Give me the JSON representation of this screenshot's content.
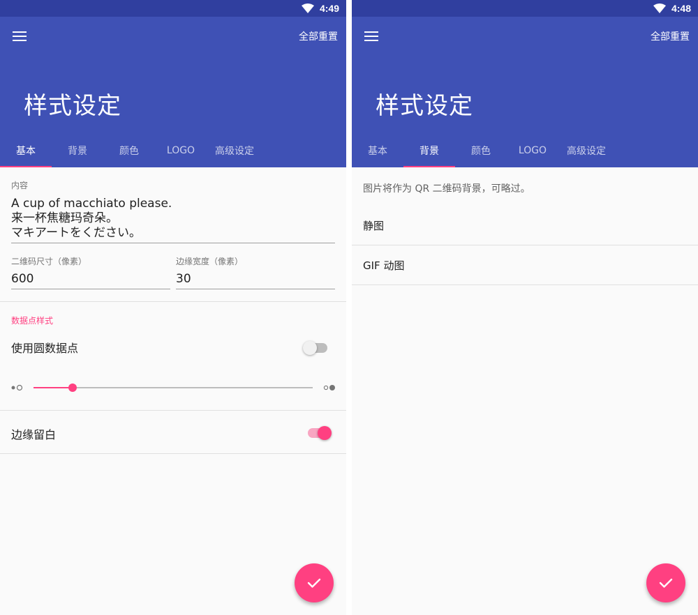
{
  "colors": {
    "primary": "#3f51b5",
    "primary_dark": "#303f9f",
    "accent": "#ff4081",
    "background": "#fafafa"
  },
  "left_screen": {
    "status": {
      "time": "4:49",
      "icons": [
        "wifi-icon"
      ]
    },
    "appbar": {
      "reset_label": "全部重置",
      "title": "样式设定"
    },
    "tabs": [
      {
        "label": "基本",
        "active": true
      },
      {
        "label": "背景",
        "active": false
      },
      {
        "label": "颜色",
        "active": false
      },
      {
        "label": "LOGO",
        "active": false
      },
      {
        "label": "高级设定",
        "active": false
      }
    ],
    "content_field": {
      "label": "内容",
      "lines": [
        "A cup of macchiato please.",
        "来一杯焦糖玛奇朵。",
        "マキアートをください。"
      ]
    },
    "size_field": {
      "label": "二维码尺寸（像素）",
      "value": "600"
    },
    "margin_field": {
      "label": "边缘宽度（像素）",
      "value": "30"
    },
    "dot_section": {
      "header": "数据点样式"
    },
    "round_dots": {
      "label": "使用圆数据点",
      "checked": false
    },
    "dot_scale_slider": {
      "value": 0.14,
      "min_icon": "small-dot-icon",
      "max_icon": "large-dot-icon"
    },
    "white_margin": {
      "label": "边缘留白",
      "checked": true
    },
    "fab": {
      "icon": "check-icon"
    }
  },
  "right_screen": {
    "status": {
      "time": "4:48",
      "icons": [
        "wifi-icon"
      ]
    },
    "appbar": {
      "reset_label": "全部重置",
      "title": "样式设定"
    },
    "tabs": [
      {
        "label": "基本",
        "active": false
      },
      {
        "label": "背景",
        "active": true
      },
      {
        "label": "颜色",
        "active": false
      },
      {
        "label": "LOGO",
        "active": false
      },
      {
        "label": "高级设定",
        "active": false
      }
    ],
    "hint": "图片将作为 QR 二维码背景，可略过。",
    "items": [
      {
        "label": "静图"
      },
      {
        "label": "GIF 动图"
      }
    ],
    "fab": {
      "icon": "check-icon"
    }
  }
}
